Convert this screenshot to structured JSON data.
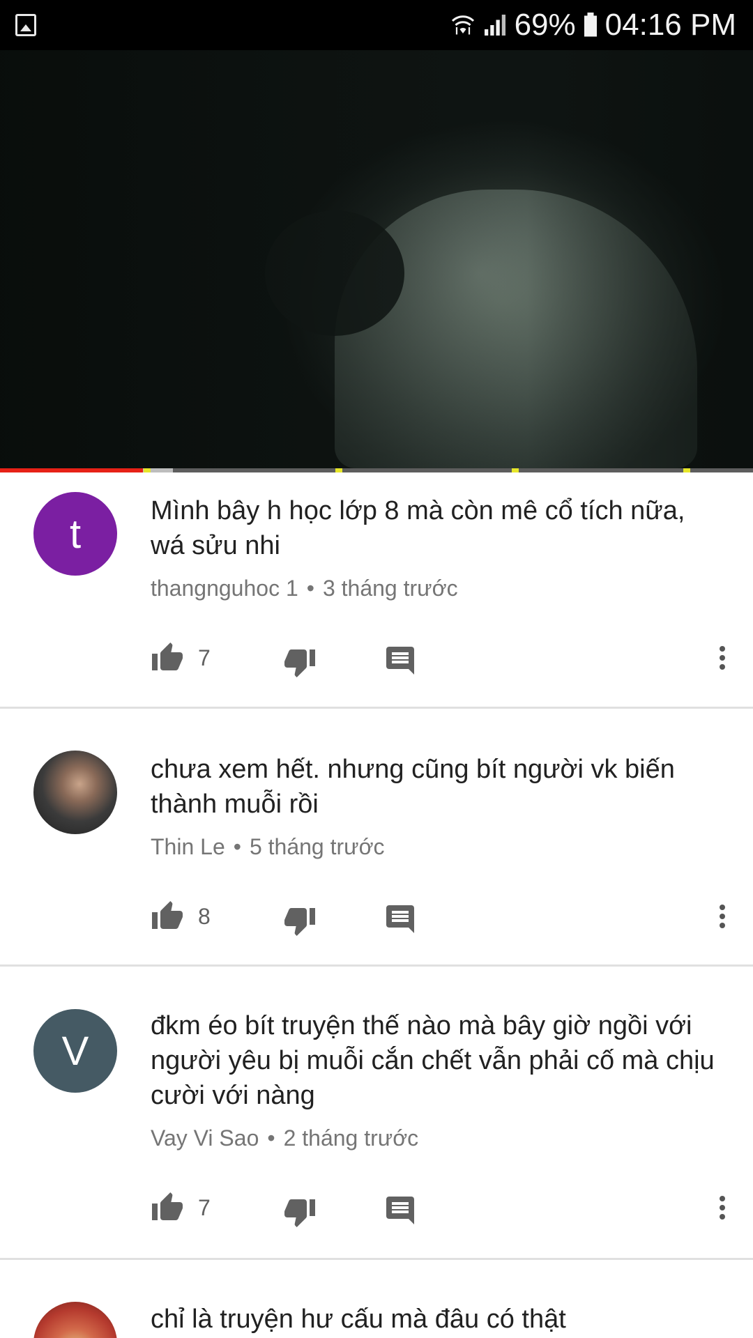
{
  "status_bar": {
    "battery_percent": "69%",
    "time": "04:16 PM",
    "icons": [
      "gallery-icon",
      "wifi-icon",
      "signal-icon",
      "battery-icon"
    ]
  },
  "video": {
    "progress": 0.19,
    "buffered": 0.23
  },
  "comments": [
    {
      "avatar_letter": "t",
      "avatar_color": "#7b1fa2",
      "text": "Mình bây h học lớp 8 mà còn mê cổ tích nữa, wá sửu nhi",
      "author": "thangnguhoc 1",
      "time": "3 tháng trước",
      "likes": "7"
    },
    {
      "avatar_letter": "",
      "avatar_color": "#3a3a3a",
      "text": "chưa xem hết. nhưng cũng bít  người vk biến thành muỗi rồi",
      "author": "Thin Le",
      "time": "5 tháng trước",
      "likes": "8"
    },
    {
      "avatar_letter": "V",
      "avatar_color": "#455a64",
      "text": "đkm éo bít truyện thế nào mà bây giờ ngồi với người yêu bị muỗi cắn chết vẫn phải cố mà chịu cười với nàng",
      "author": "Vay Vi Sao",
      "time": "2 tháng trước",
      "likes": "7"
    },
    {
      "avatar_letter": "",
      "avatar_color": "#c0392b",
      "text": "chỉ là truyện hư cấu mà đâu có thật"
    }
  ],
  "meta_separator": "•",
  "colors": {
    "progress_played": "#e62117",
    "text_primary": "#212121",
    "text_secondary": "#757575"
  }
}
